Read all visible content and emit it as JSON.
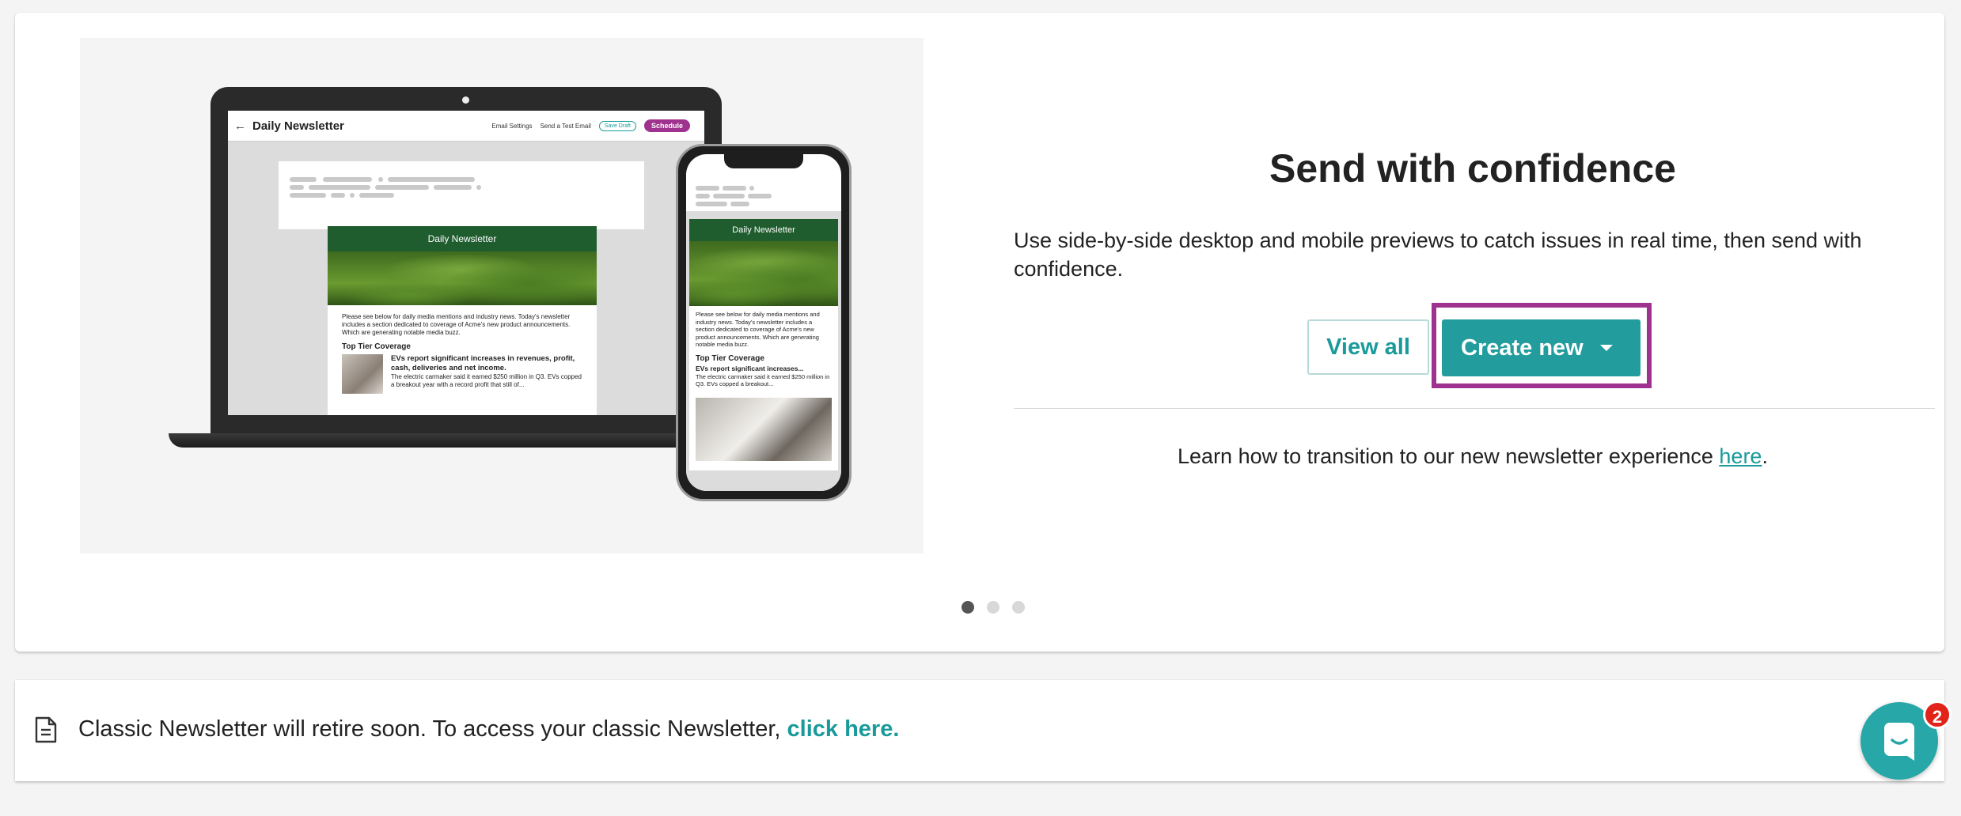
{
  "promo": {
    "headline": "Send with confidence",
    "description": "Use side-by-side desktop and mobile previews to catch issues in real time, then send with confidence.",
    "view_all_label": "View all",
    "create_new_label": "Create new",
    "learn_text": "Learn how to transition to our new newsletter experience ",
    "learn_link": "here",
    "learn_suffix": ".",
    "carousel": {
      "total": 3,
      "active": 1
    }
  },
  "illustration": {
    "laptop_title": "Daily Newsletter",
    "email_settings": "Email Settings",
    "send_test": "Send a Test Email",
    "save_draft": "Save Draft",
    "schedule": "Schedule",
    "newsletter_header": "Daily Newsletter",
    "intro": "Please see below for daily media mentions and industry news. Today's newsletter includes a section dedicated to coverage of Acme's new product announcements. Which are generating notable media buzz.",
    "section_title": "Top Tier Coverage",
    "article_title": "EVs report significant increases in revenues, profit, cash, deliveries and net income.",
    "article_snippet": "The electric carmaker said it earned $250 million in Q3. EVs copped a breakout year with a record profit that still of...",
    "phone_article_title": "EVs report significant increases...",
    "phone_article_snippet": "The electric carmaker said it earned $250 million in Q3. EVs copped a breakout..."
  },
  "notice": {
    "text": "Classic Newsletter will retire soon. To access your classic Newsletter, ",
    "link": "click here."
  },
  "chat": {
    "badge_count": "2"
  },
  "colors": {
    "accent": "#229c9c",
    "highlight": "#a0328f",
    "badge": "#e2231a"
  }
}
